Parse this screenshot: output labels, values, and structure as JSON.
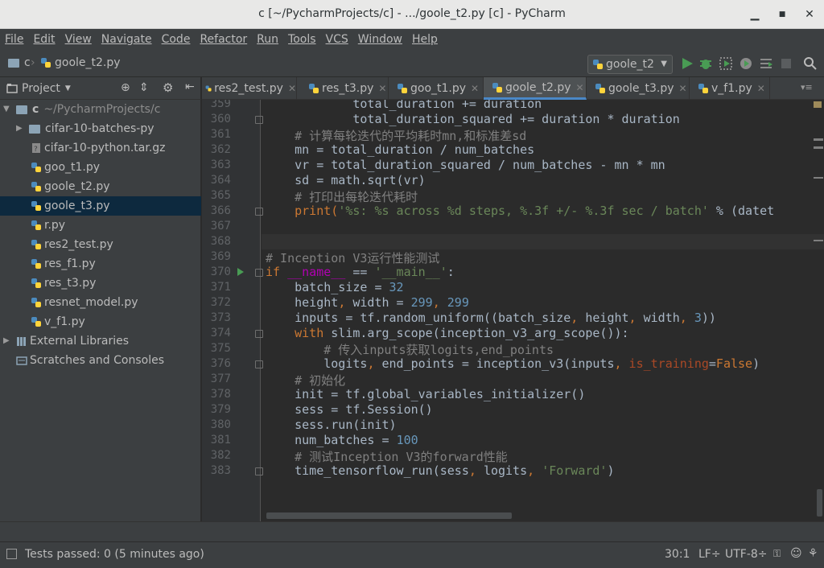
{
  "window": {
    "title": "c [~/PycharmProjects/c] - .../goole_t2.py [c] - PyCharm",
    "minimize_glyph": "▁",
    "maximize_glyph": "■",
    "close_glyph": "✕"
  },
  "menu": [
    "File",
    "Edit",
    "View",
    "Navigate",
    "Code",
    "Refactor",
    "Run",
    "Tools",
    "VCS",
    "Window",
    "Help"
  ],
  "navbar": {
    "crumb_project": "c",
    "crumb_file": "goole_t2.py",
    "run_config": "goole_t2"
  },
  "project_panel": {
    "title": "Project",
    "root_name": "c",
    "root_path": "~/PycharmProjects/c",
    "items": [
      "cifar-10-batches-py",
      "cifar-10-python.tar.gz",
      "goo_t1.py",
      "goole_t2.py",
      "goole_t3.py",
      "r.py",
      "res2_test.py",
      "res_f1.py",
      "res_t3.py",
      "resnet_model.py",
      "v_f1.py"
    ],
    "external_libraries": "External Libraries",
    "scratches": "Scratches and Consoles"
  },
  "tabs": [
    "res2_test.py",
    "res_t3.py",
    "goo_t1.py",
    "goole_t2.py",
    "goole_t3.py",
    "v_f1.py"
  ],
  "active_tab": "goole_t2.py",
  "line_numbers": [
    "359",
    "360",
    "361",
    "362",
    "363",
    "364",
    "365",
    "366",
    "367",
    "368",
    "369",
    "370",
    "371",
    "372",
    "373",
    "374",
    "375",
    "376",
    "377",
    "378",
    "379",
    "380",
    "381",
    "382",
    "383"
  ],
  "code": {
    "l359": "total_duration += duration",
    "l360": "total_duration_squared += duration * duration",
    "l361": "# 计算每轮迭代的平均耗时mn,和标准差sd",
    "l362": "mn = total_duration / num_batches",
    "l363": "vr = total_duration_squared / num_batches - mn * mn",
    "l364": "sd = math.sqrt(vr)",
    "l365": "# 打印出每轮迭代耗时",
    "l366_a": "print(",
    "l366_b": "'%s: %s across %d steps, %.3f +/- %.3f sec / batch'",
    "l366_c": " % (datet",
    "l369": "# Inception V3运行性能测试",
    "l370_a": "if ",
    "l370_b": "__name__",
    "l370_c": " == ",
    "l370_d": "'__main__'",
    "l370_e": ":",
    "l371_a": "batch_size = ",
    "l371_b": "32",
    "l372_a": "height",
    "l372_b": ", ",
    "l372_c": "width = ",
    "l372_d": "299",
    "l372_e": ", ",
    "l372_f": "299",
    "l373_a": "inputs = tf.random_uniform((batch_size",
    "l373_b": ", ",
    "l373_c": "height",
    "l373_d": ", ",
    "l373_e": "width",
    "l373_f": ", ",
    "l373_g": "3",
    "l373_h": "))",
    "l374_a": "with ",
    "l374_b": "slim.arg_scope(inception_v3_arg_scope()):",
    "l375": "# 传入inputs获取logits,end_points",
    "l376_a": "logits",
    "l376_b": ", ",
    "l376_c": "end_points = inception_v3(inputs",
    "l376_d": ", ",
    "l376_e": "is_training",
    "l376_f": "=",
    "l376_g": "False",
    "l376_h": ")",
    "l377": "# 初始化",
    "l378": "init = tf.global_variables_initializer()",
    "l379": "sess = tf.Session()",
    "l380": "sess.run(init)",
    "l381_a": "num_batches = ",
    "l381_b": "100",
    "l382": "# 测试Inception V3的forward性能",
    "l383_a": "time_tensorflow_run(sess",
    "l383_b": ", ",
    "l383_c": "logits",
    "l383_d": ", ",
    "l383_e": "'Forward'",
    "l383_f": ")"
  },
  "status": {
    "message": "Tests passed: 0 (5 minutes ago)",
    "position": "30:1",
    "line_sep": "LF÷",
    "encoding": "UTF-8÷"
  },
  "colors": {
    "accent": "#4a88c7",
    "run_green": "#499c54",
    "keyword": "#cc7832",
    "string": "#6a8759",
    "number": "#6897bb",
    "comment": "#808080"
  }
}
